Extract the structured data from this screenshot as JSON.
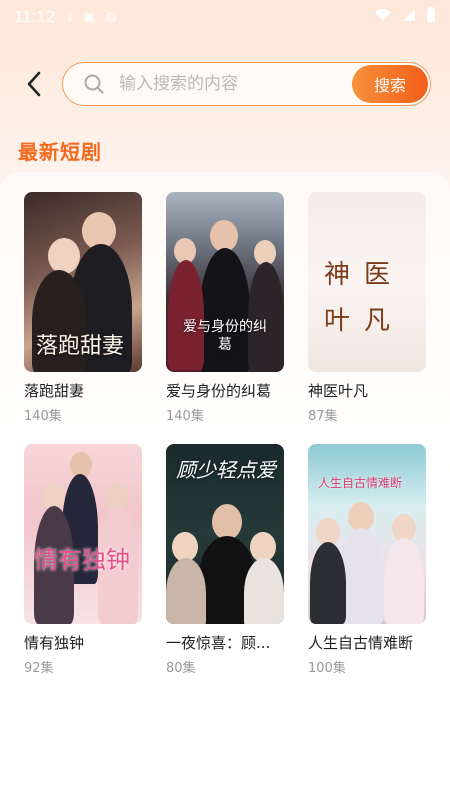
{
  "status_bar": {
    "time": "11:12"
  },
  "search": {
    "placeholder": "输入搜索的内容",
    "button_label": "搜索"
  },
  "section": {
    "title": "最新短剧"
  },
  "dramas": [
    {
      "title": "落跑甜妻",
      "episodes": "140集",
      "poster_text": "落跑甜妻"
    },
    {
      "title": "爱与身份的纠葛",
      "episodes": "140集",
      "poster_text": "爱与身份的纠葛"
    },
    {
      "title": "神医叶凡",
      "episodes": "87集",
      "poster_text": "神医叶凡"
    },
    {
      "title": "情有独钟",
      "episodes": "92集",
      "poster_text": "情有独钟"
    },
    {
      "title": "一夜惊喜：顾...",
      "episodes": "80集",
      "poster_text": "顾少轻点爱"
    },
    {
      "title": "人生自古情难断",
      "episodes": "100集",
      "poster_text": "人生自古情难断"
    }
  ]
}
